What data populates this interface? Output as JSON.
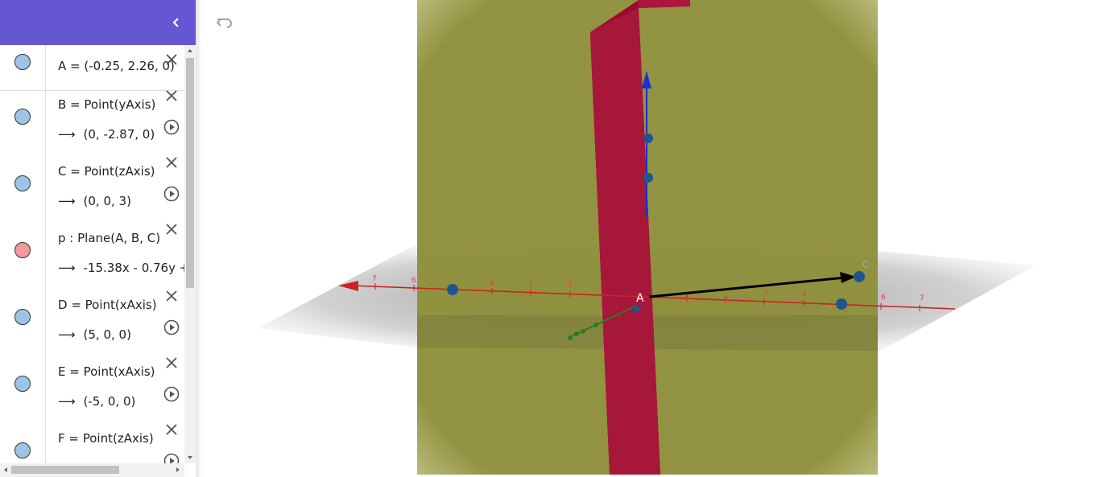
{
  "algebra": {
    "rows": [
      {
        "definition": "A = (-0.25, 2.26, 0)",
        "value": "",
        "marble_color": "#9dc3e6",
        "has_play": false
      },
      {
        "definition": "B = Point(yAxis)",
        "value": "(0, -2.87, 0)",
        "marble_color": "#9dc3e6",
        "has_play": true
      },
      {
        "definition": "C = Point(zAxis)",
        "value": "(0, 0, 3)",
        "marble_color": "#9dc3e6",
        "has_play": true
      },
      {
        "definition": "p : Plane(A, B, C)",
        "value": "-15.38x - 0.76y +",
        "marble_color": "#f29a9f",
        "has_play": false
      },
      {
        "definition": "D = Point(xAxis)",
        "value": "(5, 0, 0)",
        "marble_color": "#9dc3e6",
        "has_play": true
      },
      {
        "definition": "E = Point(xAxis)",
        "value": "(-5, 0, 0)",
        "marble_color": "#9dc3e6",
        "has_play": true
      },
      {
        "definition": "F = Point(zAxis)",
        "value": "",
        "marble_color": "#9dc3e6",
        "has_play": true
      }
    ],
    "arrow_glyph": "⟶"
  },
  "colors": {
    "header": "#6557d2",
    "olive_plane": "#8f903c",
    "red_plane": "#9a0b2e",
    "x_axis": "#cc2222",
    "z_axis": "#1b2fd0",
    "y_axis": "#2a7a2a",
    "points": "#21558f"
  },
  "scene": {
    "point_labels": [
      "A",
      "C"
    ],
    "x_axis_ticks": [
      "7",
      "6",
      "4",
      "3",
      "2",
      "1",
      "2",
      "3",
      "4",
      "6",
      "7"
    ]
  }
}
